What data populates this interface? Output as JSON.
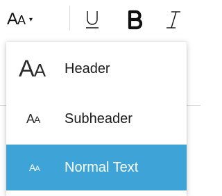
{
  "toolbar": {
    "format_button": {
      "glyph_large": "A",
      "glyph_small": "A",
      "caret": "▾"
    },
    "underline": {
      "icon": "underline-icon"
    },
    "bold": {
      "icon": "bold-icon"
    },
    "italic": {
      "icon": "italic-icon"
    }
  },
  "menu": {
    "items": [
      {
        "label": "Header",
        "glyph_large": "A",
        "glyph_small": "A",
        "selected": false
      },
      {
        "label": "Subheader",
        "glyph_large": "A",
        "glyph_small": "A",
        "selected": false
      },
      {
        "label": "Normal Text",
        "glyph_large": "A",
        "glyph_small": "A",
        "selected": true
      }
    ]
  },
  "colors": {
    "selected_bg": "#3ea4d8",
    "text": "#1a1a1a"
  }
}
